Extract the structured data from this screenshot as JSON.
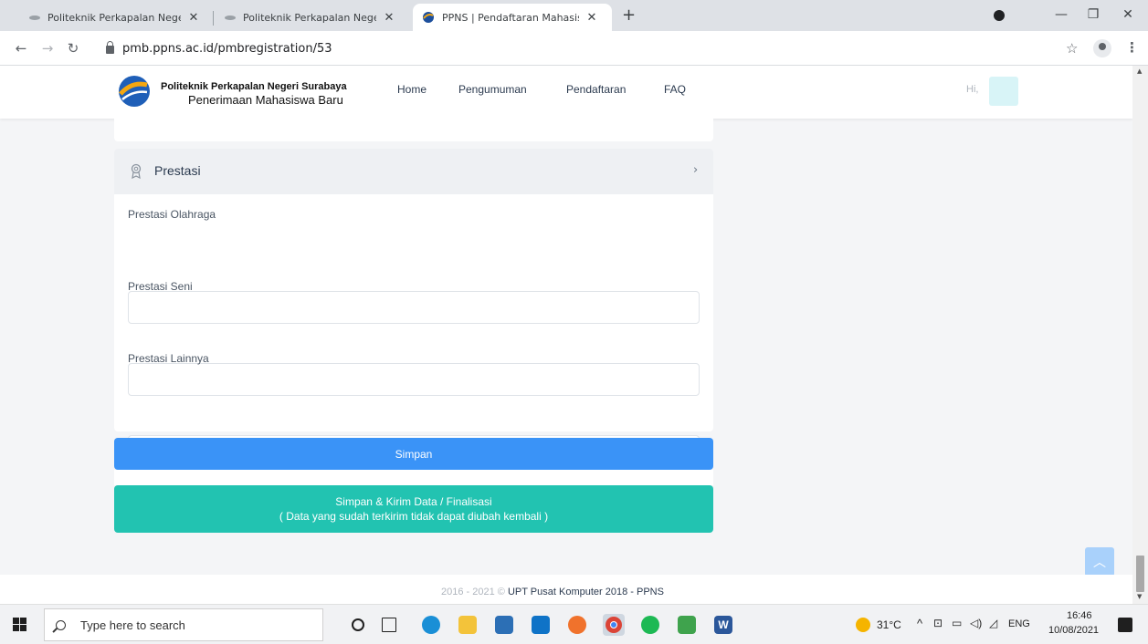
{
  "browser": {
    "tabs": [
      {
        "title": "Politeknik Perkapalan Negeri Sura"
      },
      {
        "title": "Politeknik Perkapalan Negeri Sura"
      },
      {
        "title": "PPNS | Pendaftaran Mahasiswa B"
      }
    ],
    "url": "pmb.ppns.ac.id/pmbregistration/53"
  },
  "header": {
    "brand_line1": "Politeknik Perkapalan Negeri Surabaya",
    "brand_line2": "Penerimaan Mahasiswa Baru",
    "nav": [
      "Home",
      "Pengumuman",
      "Pendaftaran",
      "FAQ"
    ],
    "greeting": "Hi,"
  },
  "section": {
    "title": "Prestasi",
    "fields": [
      {
        "label": "Prestasi Olahraga",
        "value": ""
      },
      {
        "label": "Prestasi Seni",
        "value": ""
      },
      {
        "label": "Prestasi Lainnya",
        "value": ""
      }
    ]
  },
  "buttons": {
    "save": "Simpan",
    "final_line1": "Simpan & Kirim Data / Finalisasi",
    "final_line2": "( Data yang sudah terkirim tidak dapat diubah kembali )"
  },
  "footer": {
    "years": "2016 - 2021 ©",
    "org": "UPT Pusat Komputer 2018 - PPNS"
  },
  "taskbar": {
    "search_placeholder": "Type here to search",
    "weather": "31°C",
    "language": "ENG",
    "time": "16:46",
    "date": "10/08/2021"
  },
  "colors": {
    "save_button": "#3a93f7",
    "final_button": "#22c3b1"
  }
}
